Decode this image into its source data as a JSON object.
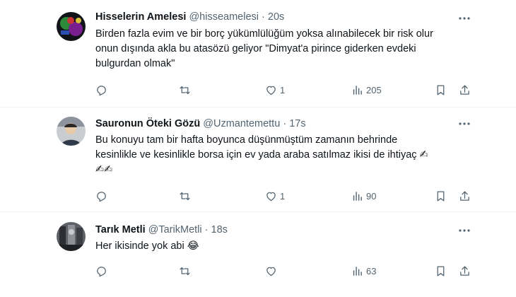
{
  "tweets": [
    {
      "name": "Hisselerin Amelesi",
      "handle": "@hisseamelesi",
      "time": "20s",
      "text": "Birden fazla evim ve bir borç yükümlülüğüm yoksa alınabilecek bir risk olur\nonun dışında akla bu atasözü geliyor \"Dimyat'a pirince giderken evdeki\nbulgurdan olmak\"",
      "replies": "",
      "reposts": "",
      "likes": "1",
      "views": "205"
    },
    {
      "name": "Sauronun Öteki Gözü",
      "handle": "@Uzmantemettu",
      "time": "17s",
      "text": "Bu konuyu tam bir hafta boyunca düşünmüştüm zamanın behrinde\nkesinlikle ve kesinlikle borsa için ev yada araba satılmaz ikisi de ihtiyaç ✍\n✍✍",
      "replies": "",
      "reposts": "",
      "likes": "1",
      "views": "90"
    },
    {
      "name": "Tarık Metli",
      "handle": "@TarikMetli",
      "time": "18s",
      "text": "Her ikisinde yok abi 😂",
      "replies": "",
      "reposts": "",
      "likes": "",
      "views": "63"
    }
  ],
  "separator": "·",
  "icons": {
    "more": "more-horizontal-icon",
    "reply": "reply-icon",
    "repost": "repost-icon",
    "like": "heart-icon",
    "views": "views-chart-icon",
    "bookmark": "bookmark-icon",
    "share": "share-icon"
  },
  "colors": {
    "text": "#0f1419",
    "secondary": "#536471",
    "divider": "#eff3f4"
  }
}
